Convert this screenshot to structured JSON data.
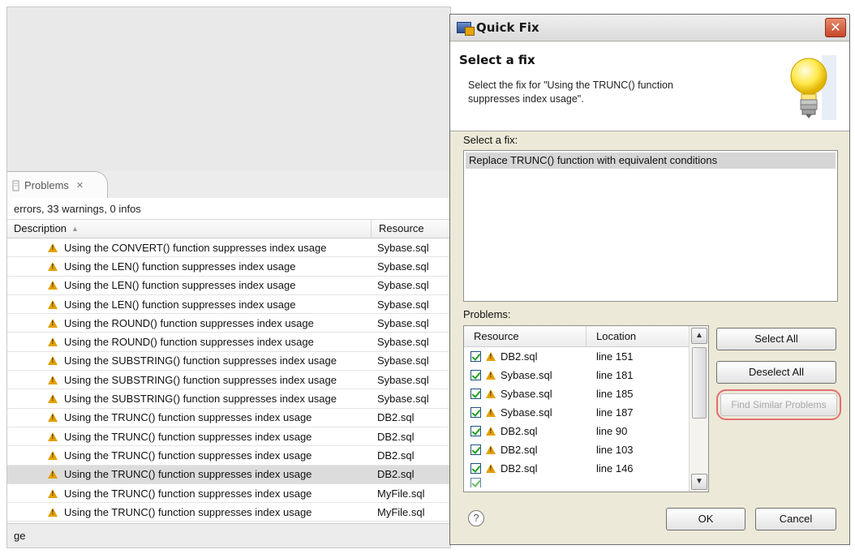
{
  "problems_view": {
    "tab_label": "Problems",
    "summary": "errors, 33 warnings, 0 infos",
    "columns": {
      "description": "Description",
      "resource": "Resource"
    },
    "rows": [
      {
        "description": "Using the CONVERT() function suppresses index usage",
        "resource": "Sybase.sql"
      },
      {
        "description": "Using the LEN() function suppresses index usage",
        "resource": "Sybase.sql"
      },
      {
        "description": "Using the LEN() function suppresses index usage",
        "resource": "Sybase.sql"
      },
      {
        "description": "Using the LEN() function suppresses index usage",
        "resource": "Sybase.sql"
      },
      {
        "description": "Using the ROUND() function suppresses index usage",
        "resource": "Sybase.sql"
      },
      {
        "description": "Using the ROUND() function suppresses index usage",
        "resource": "Sybase.sql"
      },
      {
        "description": "Using the SUBSTRING() function suppresses index usage",
        "resource": "Sybase.sql"
      },
      {
        "description": "Using the SUBSTRING() function suppresses index usage",
        "resource": "Sybase.sql"
      },
      {
        "description": "Using the SUBSTRING() function suppresses index usage",
        "resource": "Sybase.sql"
      },
      {
        "description": "Using the TRUNC() function suppresses index usage",
        "resource": "DB2.sql"
      },
      {
        "description": "Using the TRUNC() function suppresses index usage",
        "resource": "DB2.sql"
      },
      {
        "description": "Using the TRUNC() function suppresses index usage",
        "resource": "DB2.sql"
      },
      {
        "description": "Using the TRUNC() function suppresses index usage",
        "resource": "DB2.sql"
      },
      {
        "description": "Using the TRUNC() function suppresses index usage",
        "resource": "MyFile.sql"
      },
      {
        "description": "Using the TRUNC() function suppresses index usage",
        "resource": "MyFile.sql"
      }
    ],
    "status_text": "ge"
  },
  "dialog": {
    "title": "Quick Fix",
    "header_title": "Select a fix",
    "header_description": "Select the fix for \"Using the TRUNC() function suppresses index usage\".",
    "fix_label": "Select a fix:",
    "fixes": [
      "Replace TRUNC() function with equivalent conditions"
    ],
    "problems_label": "Problems:",
    "problem_columns": {
      "resource": "Resource",
      "location": "Location"
    },
    "problems": [
      {
        "resource": "DB2.sql",
        "location": "line 151",
        "checked": true
      },
      {
        "resource": "Sybase.sql",
        "location": "line 181",
        "checked": true
      },
      {
        "resource": "Sybase.sql",
        "location": "line 185",
        "checked": true
      },
      {
        "resource": "Sybase.sql",
        "location": "line 187",
        "checked": true
      },
      {
        "resource": "DB2.sql",
        "location": "line 90",
        "checked": true
      },
      {
        "resource": "DB2.sql",
        "location": "line 103",
        "checked": true
      },
      {
        "resource": "DB2.sql",
        "location": "line 146",
        "checked": true
      }
    ],
    "buttons": {
      "select_all": "Select All",
      "deselect_all": "Deselect All",
      "find_similar": "Find Similar Problems",
      "ok": "OK",
      "cancel": "Cancel"
    },
    "help_glyph": "?",
    "close_glyph": "✕"
  }
}
